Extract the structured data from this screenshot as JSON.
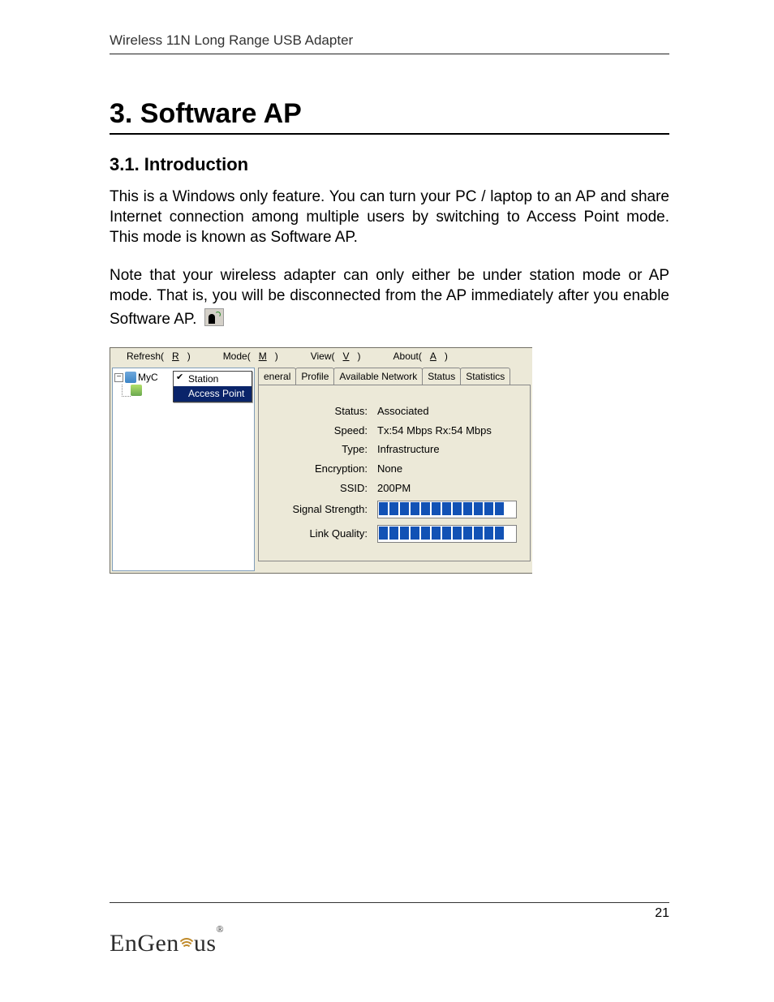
{
  "header": "Wireless 11N Long Range USB Adapter",
  "title": "3. Software AP",
  "subtitle": "3.1. Introduction",
  "para1": "This is a Windows only feature. You can turn your PC / laptop to an AP and share Internet connection among multiple users by switching to Access Point mode. This mode is known as Software AP.",
  "para2": "Note that your wireless adapter can only either be under station mode or AP mode. That is, you will be disconnected from the AP immediately after you enable Software AP.",
  "app": {
    "menu": {
      "refresh": "Refresh(",
      "refresh_u": "R",
      "refresh2": ")",
      "mode": "Mode(",
      "mode_u": "M",
      "mode2": ")",
      "view": "View(",
      "view_u": "V",
      "view2": ")",
      "about": "About(",
      "about_u": "A",
      "about2": ")"
    },
    "tree": {
      "root": "MyC",
      "mode_items": [
        "Station",
        "Access Point"
      ]
    },
    "tabs": [
      "eneral",
      "Profile",
      "Available Network",
      "Status",
      "Statistics"
    ],
    "labels": {
      "status": "Status:",
      "speed": "Speed:",
      "type": "Type:",
      "enc": "Encryption:",
      "ssid": "SSID:",
      "signal": "Signal Strength:",
      "link": "Link Quality:"
    },
    "values": {
      "status": "Associated",
      "speed": "Tx:54 Mbps Rx:54 Mbps",
      "type": "Infrastructure",
      "enc": "None",
      "ssid": "200PM"
    }
  },
  "page_number": "21",
  "logo": {
    "a": "EnGen",
    "b": "us",
    "reg": "®"
  }
}
